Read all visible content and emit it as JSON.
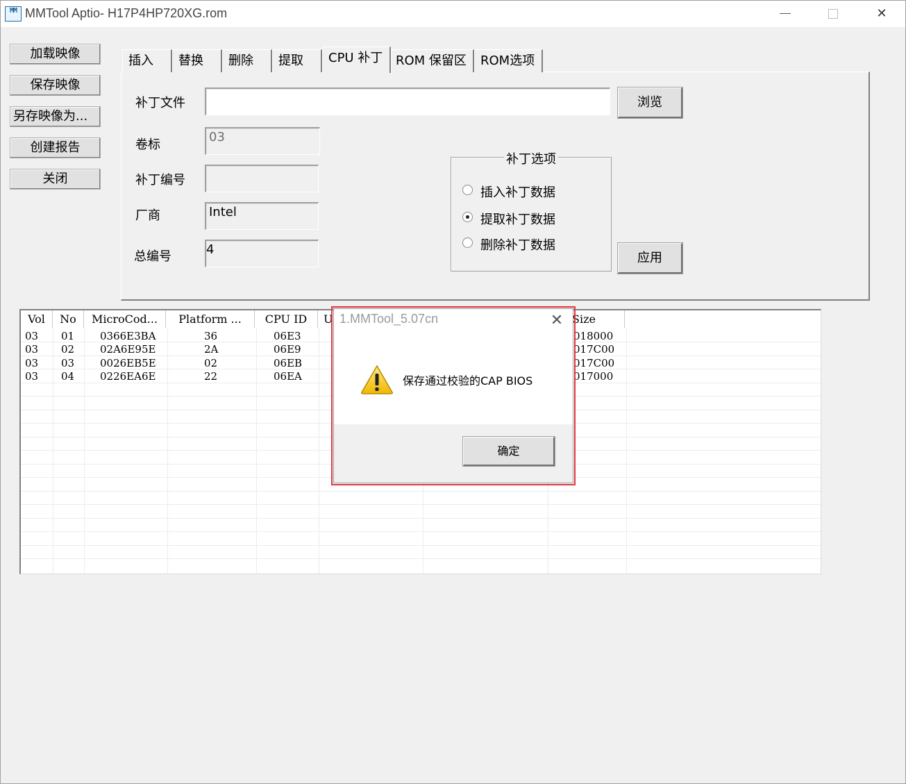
{
  "window": {
    "title": "MMTool Aptio- H17P4HP720XG.rom",
    "icon_text": "MM"
  },
  "sidebar": {
    "buttons": [
      {
        "label": "加载映像"
      },
      {
        "label": "保存映像"
      },
      {
        "label": "另存映像为..."
      },
      {
        "label": "创建报告"
      },
      {
        "label": "关闭"
      }
    ]
  },
  "tabs": [
    {
      "label": "插入"
    },
    {
      "label": "替换"
    },
    {
      "label": "删除"
    },
    {
      "label": "提取"
    },
    {
      "label": "CPU 补丁"
    },
    {
      "label": "ROM 保留区"
    },
    {
      "label": "ROM选项"
    }
  ],
  "active_tab": "CPU 补丁",
  "patch": {
    "file_label": "补丁文件",
    "file_value": "",
    "browse_label": "浏览",
    "volume_label": "卷标",
    "volume_value": "03",
    "patch_no_label": "补丁编号",
    "patch_no_value": "",
    "vendor_label": "厂商",
    "vendor_value": "Intel",
    "total_label": "总编号",
    "total_value": "4",
    "apply_label": "应用",
    "options_title": "补丁选项",
    "options": [
      {
        "label": "插入补丁数据",
        "selected": false
      },
      {
        "label": "提取补丁数据",
        "selected": true
      },
      {
        "label": "删除补丁数据",
        "selected": false
      }
    ]
  },
  "table": {
    "columns": [
      "Vol",
      "No",
      "MicroCod...",
      "Platform ...",
      "CPU ID",
      "U:",
      "",
      "Size",
      ""
    ],
    "rows": [
      [
        "03",
        "01",
        "0366E3BA",
        "36",
        "06E3",
        "018000"
      ],
      [
        "03",
        "02",
        "02A6E95E",
        "2A",
        "06E9",
        "017C00"
      ],
      [
        "03",
        "03",
        "0026EB5E",
        "02",
        "06EB",
        "017C00"
      ],
      [
        "03",
        "04",
        "0226EA6E",
        "22",
        "06EA",
        "017000"
      ]
    ]
  },
  "dialog": {
    "title": "1.MMTool_5.07cn",
    "message": "保存通过校验的CAP BIOS",
    "ok_label": "确定"
  },
  "colors": {
    "highlight_border": "#e0353a",
    "window_bg": "#f0f0f0"
  }
}
